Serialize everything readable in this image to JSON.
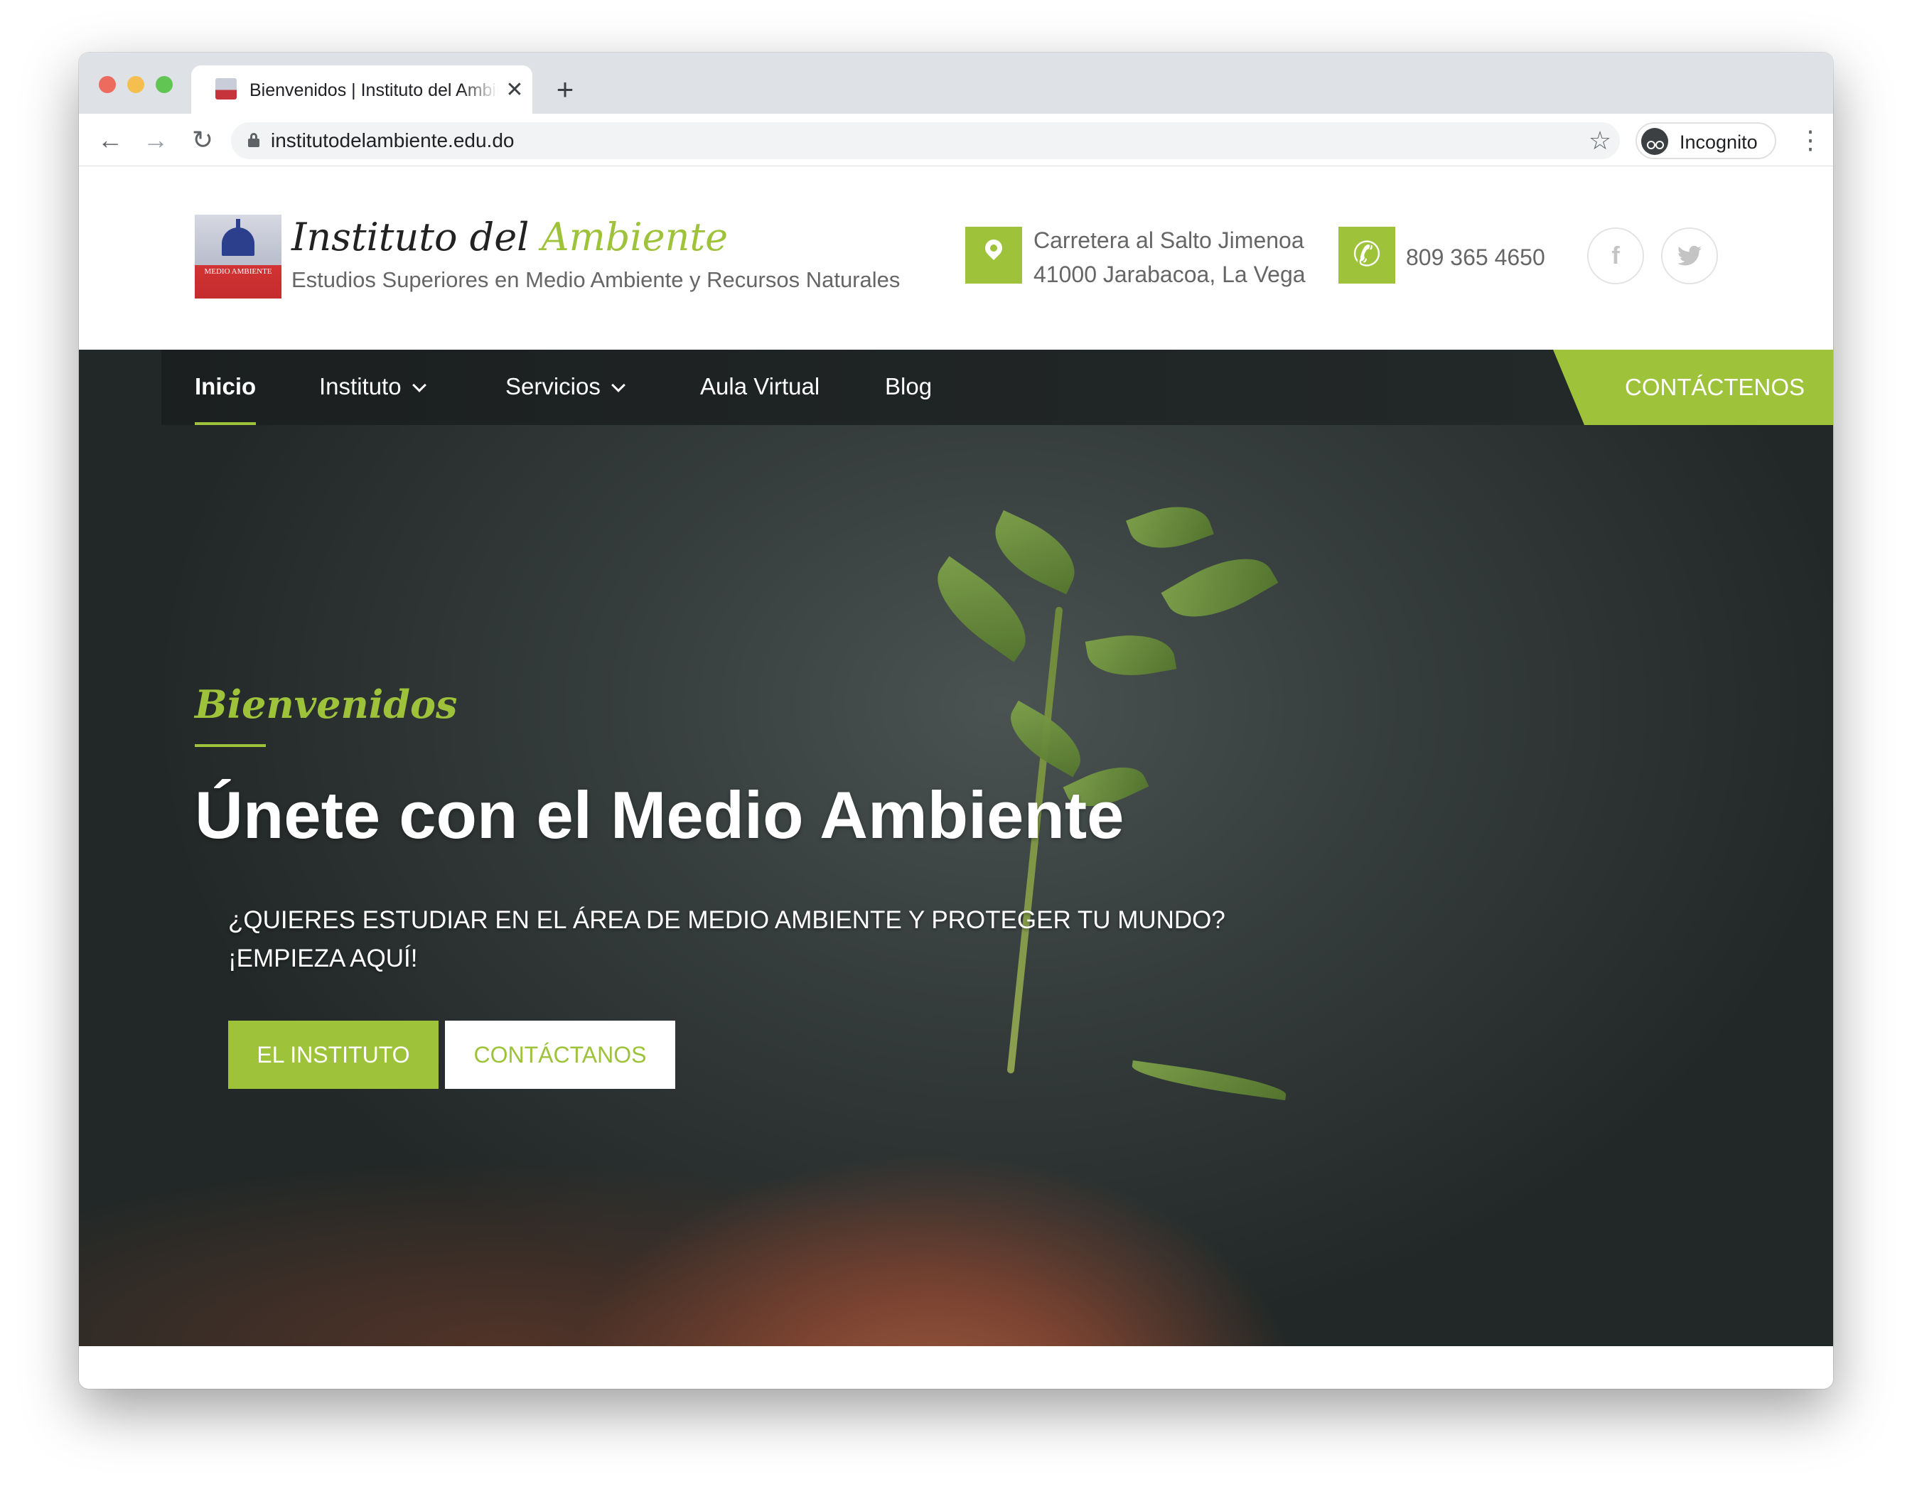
{
  "browser": {
    "tab_title": "Bienvenidos | Instituto del Ambiente",
    "tab_close": "✕",
    "new_tab": "+",
    "url": "institutodelambiente.edu.do",
    "incognito_label": "Incognito",
    "icons": {
      "back": "←",
      "forward": "→",
      "reload": "↻",
      "star": "☆",
      "menu": "⋮"
    }
  },
  "header": {
    "logo_text": "MEDIO AMBIENTE",
    "title_part1": "Instituto del ",
    "title_part2": "Ambiente",
    "tagline": "Estudios Superiores en Medio Ambiente y Recursos Naturales",
    "address_line1": "Carretera al Salto Jimenoa",
    "address_line2": "41000 Jarabacoa, La Vega",
    "phone": "809 365 4650",
    "social": {
      "facebook": "f",
      "twitter": "t"
    }
  },
  "nav": {
    "items": [
      {
        "label": "Inicio"
      },
      {
        "label": "Instituto"
      },
      {
        "label": "Servicios"
      },
      {
        "label": "Aula Virtual"
      },
      {
        "label": "Blog"
      }
    ],
    "cta": "CONTÁCTENOS"
  },
  "hero": {
    "kicker": "Bienvenidos",
    "title": "Únete con el Medio Ambiente",
    "subtitle_line1": "¿QUIERES ESTUDIAR EN EL ÁREA DE MEDIO AMBIENTE Y PROTEGER TU MUNDO?",
    "subtitle_line2": "¡EMPIEZA AQUÍ!",
    "primary_button": "EL INSTITUTO",
    "secondary_button": "CONTÁCTANOS"
  },
  "colors": {
    "accent": "#9ec33b",
    "nav_bg": "#1b1f1f",
    "text_dark": "#222222",
    "text_muted": "#666666"
  }
}
